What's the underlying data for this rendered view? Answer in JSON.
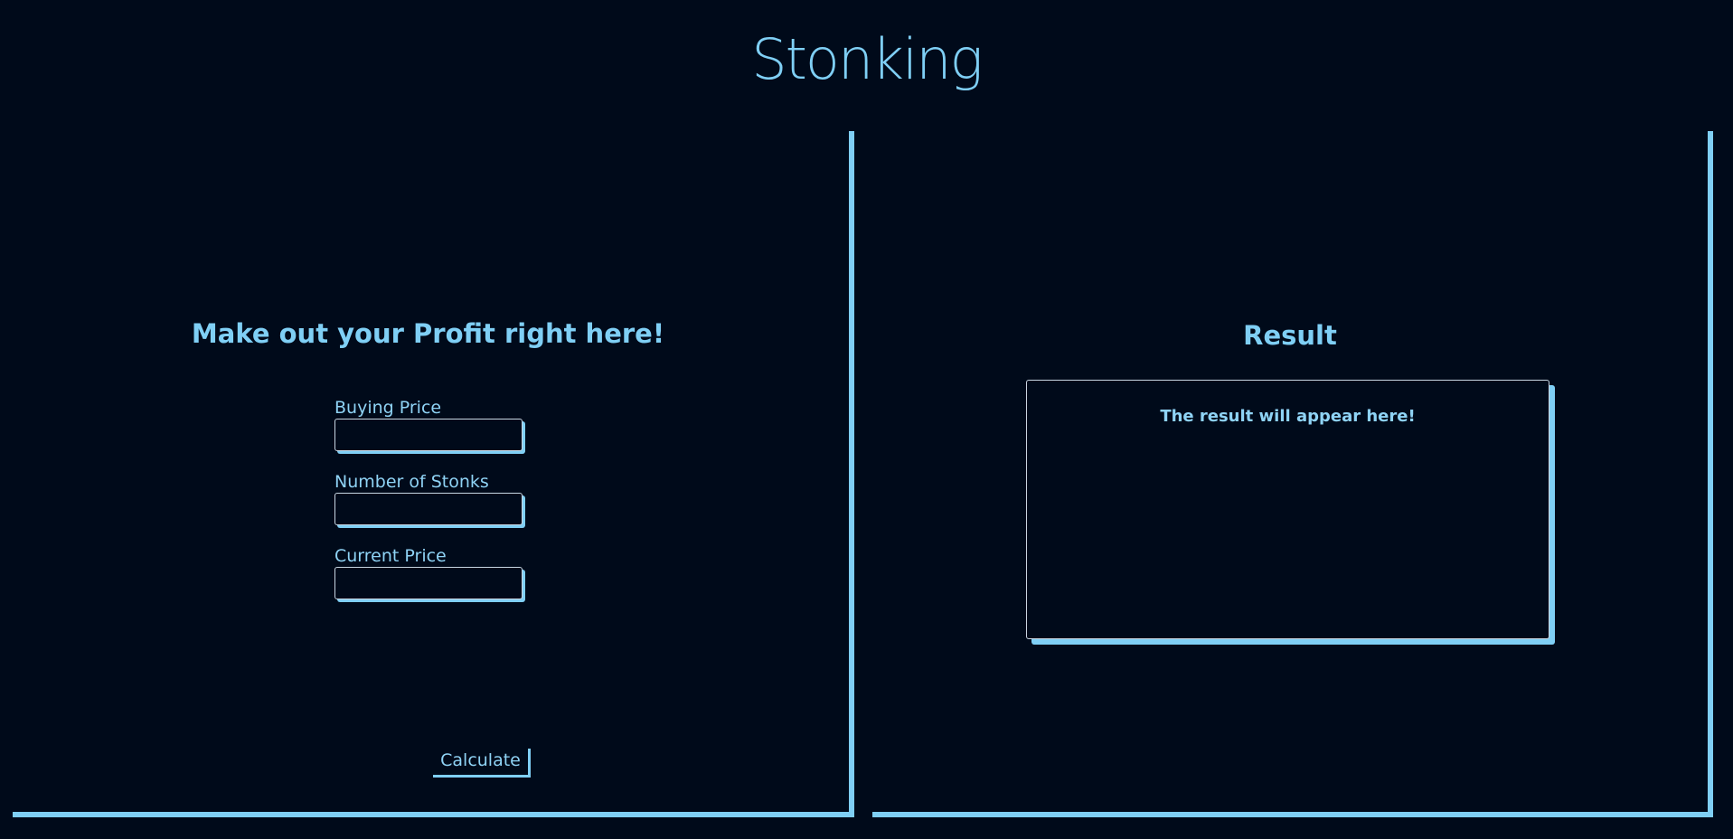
{
  "header": {
    "title": "Stonking"
  },
  "calculator": {
    "heading": "Make out your Profit right here!",
    "fields": [
      {
        "label": "Buying Price",
        "value": "",
        "placeholder": ""
      },
      {
        "label": "Number of Stonks",
        "value": "",
        "placeholder": ""
      },
      {
        "label": "Current Price",
        "value": "",
        "placeholder": ""
      }
    ],
    "button_label": "Calculate"
  },
  "result": {
    "heading": "Result",
    "message": "The result will appear here!"
  },
  "colors": {
    "background": "#000a1a",
    "accent": "#7fcff5",
    "input_border": "#c9d6e2"
  }
}
